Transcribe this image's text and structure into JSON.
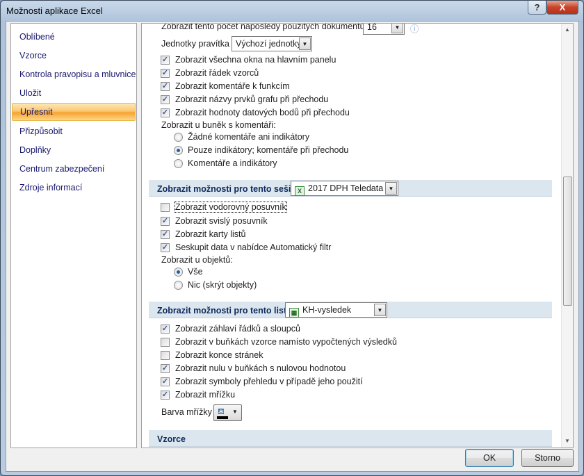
{
  "window": {
    "title": "Možnosti aplikace Excel",
    "help": "?",
    "close": "X"
  },
  "sidebar": {
    "items": [
      {
        "label": "Oblíbené"
      },
      {
        "label": "Vzorce"
      },
      {
        "label": "Kontrola pravopisu a mluvnice"
      },
      {
        "label": "Uložit"
      },
      {
        "label": "Upřesnit",
        "selected": true
      },
      {
        "label": "Přizpůsobit"
      },
      {
        "label": "Doplňky"
      },
      {
        "label": "Centrum zabezpečení"
      },
      {
        "label": "Zdroje informací"
      }
    ]
  },
  "display": {
    "recent_docs_label": "Zobrazit tento počet naposledy použitých dokumentů:",
    "recent_docs_value": "16",
    "ruler_label": "Jednotky pravítka",
    "ruler_value": "Výchozí jednotky",
    "checks": [
      {
        "label": "Zobrazit všechna okna na hlavním panelu",
        "checked": true
      },
      {
        "label": "Zobrazit řádek vzorců",
        "checked": true
      },
      {
        "label": "Zobrazit komentáře k funkcím",
        "checked": true
      },
      {
        "label": "Zobrazit názvy prvků grafu při přechodu",
        "checked": true
      },
      {
        "label": "Zobrazit hodnoty datových bodů při přechodu",
        "checked": true
      }
    ],
    "comments_label": "Zobrazit u buněk s komentáři:",
    "comments_options": [
      {
        "label": "Žádné komentáře ani indikátory",
        "selected": false
      },
      {
        "label": "Pouze indikátory; komentáře při přechodu",
        "selected": true
      },
      {
        "label": "Komentáře a indikátory",
        "selected": false
      }
    ]
  },
  "workbook": {
    "header": "Zobrazit možnosti pro tento sešit:",
    "value": "2017 DPH Teledata ...",
    "checks": [
      {
        "label": "Zobrazit vodorovný posuvník",
        "checked": false
      },
      {
        "label": "Zobrazit svislý posuvník",
        "checked": true
      },
      {
        "label": "Zobrazit karty listů",
        "checked": true
      },
      {
        "label": "Seskupit data v nabídce Automatický filtr",
        "checked": true
      }
    ],
    "objects_label": "Zobrazit u objektů:",
    "objects_options": [
      {
        "label": "Vše",
        "selected": true
      },
      {
        "label": "Nic (skrýt objekty)",
        "selected": false
      }
    ]
  },
  "sheet": {
    "header": "Zobrazit možnosti pro tento list:",
    "value": "KH-vysledek",
    "checks": [
      {
        "label": "Zobrazit záhlaví řádků a sloupců",
        "checked": true
      },
      {
        "label": "Zobrazit v buňkách vzorce namísto vypočtených výsledků",
        "checked": false
      },
      {
        "label": "Zobrazit konce stránek",
        "checked": false
      },
      {
        "label": "Zobrazit nulu v buňkách s nulovou hodnotou",
        "checked": true
      },
      {
        "label": "Zobrazit symboly přehledu v případě jeho použití",
        "checked": true
      },
      {
        "label": "Zobrazit mřížku",
        "checked": true
      }
    ],
    "grid_color_label": "Barva mřížky",
    "grid_color": "#000000"
  },
  "formulas": {
    "header": "Vzorce"
  },
  "buttons": {
    "ok": "OK",
    "cancel": "Storno"
  }
}
